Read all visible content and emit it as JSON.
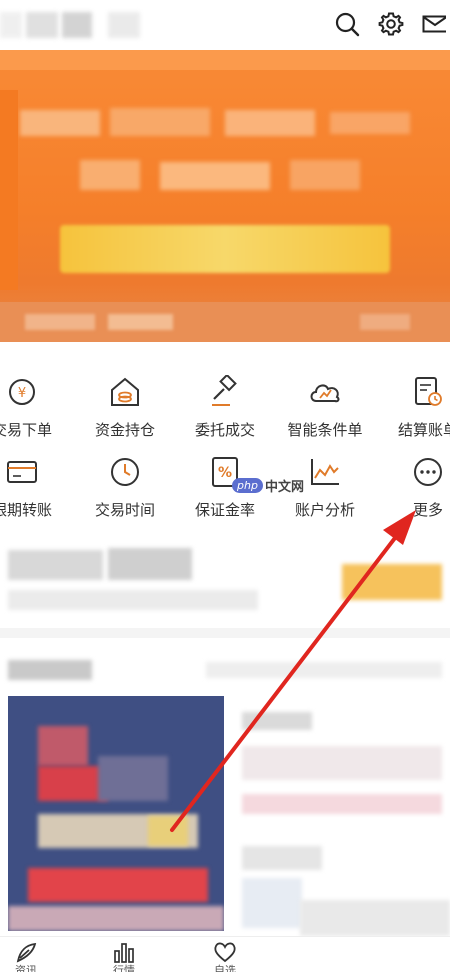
{
  "header": {
    "icons": [
      "search-icon",
      "gear-icon",
      "mail-icon"
    ]
  },
  "quick_menu": {
    "row1": [
      {
        "label": "交易下单",
        "icon": "yuan-coin-icon"
      },
      {
        "label": "资金持仓",
        "icon": "house-coins-icon"
      },
      {
        "label": "委托成交",
        "icon": "gavel-icon"
      },
      {
        "label": "智能条件单",
        "icon": "cloud-chart-icon"
      },
      {
        "label": "结算账单",
        "icon": "statement-clock-icon"
      }
    ],
    "row2": [
      {
        "label": "银期转账",
        "icon": "card-icon"
      },
      {
        "label": "交易时间",
        "icon": "clock-icon"
      },
      {
        "label": "保证金率",
        "icon": "percent-doc-icon"
      },
      {
        "label": "账户分析",
        "icon": "line-chart-icon"
      },
      {
        "label": "更多",
        "icon": "more-dots-icon"
      }
    ]
  },
  "watermark": {
    "logo": "php",
    "text": "中文网"
  },
  "bottom_nav": {
    "items": [
      {
        "label": "资讯",
        "icon": "feather-icon"
      },
      {
        "label": "行情",
        "icon": "bar-chart-icon"
      },
      {
        "label": "自选",
        "icon": "heart-icon"
      }
    ]
  },
  "colors": {
    "banner": "#f57f2a",
    "icon_accent": "#e07b2a",
    "arrow": "#e0261f"
  }
}
